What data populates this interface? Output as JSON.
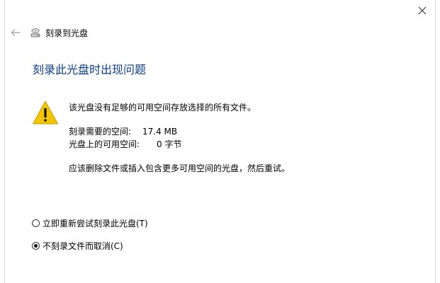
{
  "window": {
    "title": "刻录到光盘",
    "close_icon": "close-icon",
    "back_icon": "back-arrow-icon",
    "title_icon": "disc-drive-icon"
  },
  "dialog": {
    "heading": "刻录此光盘时出现问题",
    "warning_icon": "warning-icon",
    "message": "该光盘没有足够的可用空间存放选择的所有文件。",
    "space_needed_label": "刻录需要的空间:",
    "space_needed_value": "17.4 MB",
    "space_available_label": "光盘上的可用空间:",
    "space_available_value": "0 字节",
    "advice": "应该删除文件或插入包含更多可用空间的光盘，然后重试。"
  },
  "options": [
    {
      "label": "立即重新尝试刻录此光盘(T)",
      "checked": false
    },
    {
      "label": "不刻录文件而取消(C)",
      "checked": true
    }
  ],
  "colors": {
    "heading": "#0b3d91",
    "warning_fill": "#f5c400",
    "border": "#d9d9d9"
  }
}
